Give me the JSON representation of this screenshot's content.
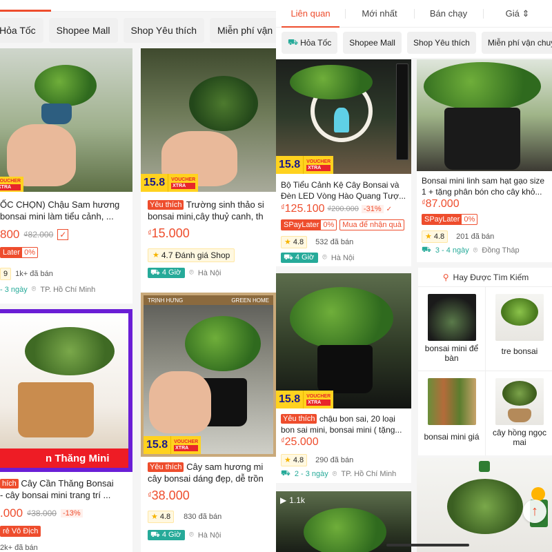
{
  "left": {
    "chips": [
      "Hỏa Tốc",
      "Shopee Mall",
      "Shop Yêu thích",
      "Miễn phí vận"
    ],
    "cards": [
      {
        "title1": "ỐC CHỌN) Chậu Sam hương",
        "title2": "bonsai mini làm tiểu cảnh, ...",
        "price": "800",
        "old_price": "₫82.000",
        "spay_b": "0%",
        "spay_a": "Later",
        "rating": "9",
        "sold": "1k+ đã bán",
        "delivery": "- 3 ngày",
        "location": "TP. Hồ Chí Minh"
      },
      {
        "tag": "Yêu thích",
        "title1": "Trường sinh thảo si",
        "title2": "bonsai mini,cây thuỷ canh, th",
        "currency": "₫",
        "price": "15.000",
        "shop_rating": "4.7 Đánh giá Shop",
        "delivery": "4 Giờ",
        "location": "Hà Nội",
        "badge": "15.8"
      },
      {
        "banner": "n Thăng Mini",
        "tag": "hích",
        "title1": "Cây Cần Thăng Bonsai",
        "title2": "- cây bonsai mini trang trí ...",
        "price": ".000",
        "old_price": "₫38.000",
        "discount": "-13%",
        "promo": "rẻ Vô Địch",
        "sold": "2k+ đã bán"
      },
      {
        "brand1": "TRỊNH HƯNG",
        "brand2": "GREEN HOME",
        "tag": "Yêu thích",
        "title1": "Cây sam hương mi",
        "title2": "cây bonsai dáng đẹp, dễ trồn",
        "currency": "₫",
        "price": "38.000",
        "rating": "4.8",
        "sold": "830 đã bán",
        "delivery": "4 Giờ",
        "location": "Hà Nội",
        "badge": "15.8"
      }
    ],
    "voucher_line1": "VOUCHER",
    "voucher_line2": "XTRA"
  },
  "right": {
    "tabs": [
      "Liên quan",
      "Mới nhất",
      "Bán chạy",
      "Giá"
    ],
    "chips": [
      "Hỏa Tốc",
      "Shopee Mall",
      "Shop Yêu thích",
      "Miễn phí vận chuy"
    ],
    "cards": [
      {
        "title": "Bộ Tiểu Cảnh Kệ Cây Bonsai và Đèn LED Vòng Hào Quang Tượ...",
        "currency": "₫",
        "price": "125.100",
        "old_price": "₫200.000",
        "discount": "-31%",
        "spay_a": "SPayLater",
        "spay_b": "0%",
        "promo": "Mua để nhận quà",
        "rating": "4.8",
        "sold": "532 đã bán",
        "delivery": "4 Giờ",
        "location": "Hà Nội",
        "badge": "15.8"
      },
      {
        "title": "Bonsai mini linh sam hạt gạo size 1 + tặng phân bón cho cây khỏ...",
        "currency": "₫",
        "price": "87.000",
        "spay_a": "SPayLater",
        "spay_b": "0%",
        "rating": "4.8",
        "sold": "201 đã bán",
        "delivery": "3 - 4 ngày",
        "location": "Đồng Tháp"
      },
      {
        "tag": "Yêu thích",
        "title": "chậu bon sai, 20 loại bon sai mini, bonsai mini ( tặng...",
        "currency": "₫",
        "price": "25.000",
        "rating": "4.8",
        "sold": "290 đã bán",
        "delivery": "2 - 3 ngày",
        "location": "TP. Hồ Chí Minh",
        "badge": "15.8"
      }
    ],
    "suggest": {
      "header": "Hay Được Tìm Kiếm",
      "items": [
        "bonsai mini để bàn",
        "tre bonsai",
        "bonsai mini giá",
        "cây hồng ngọc mai"
      ]
    },
    "video_count": "1.1k",
    "voucher_line1": "VOUCHER",
    "voucher_line2": "XTRA"
  }
}
